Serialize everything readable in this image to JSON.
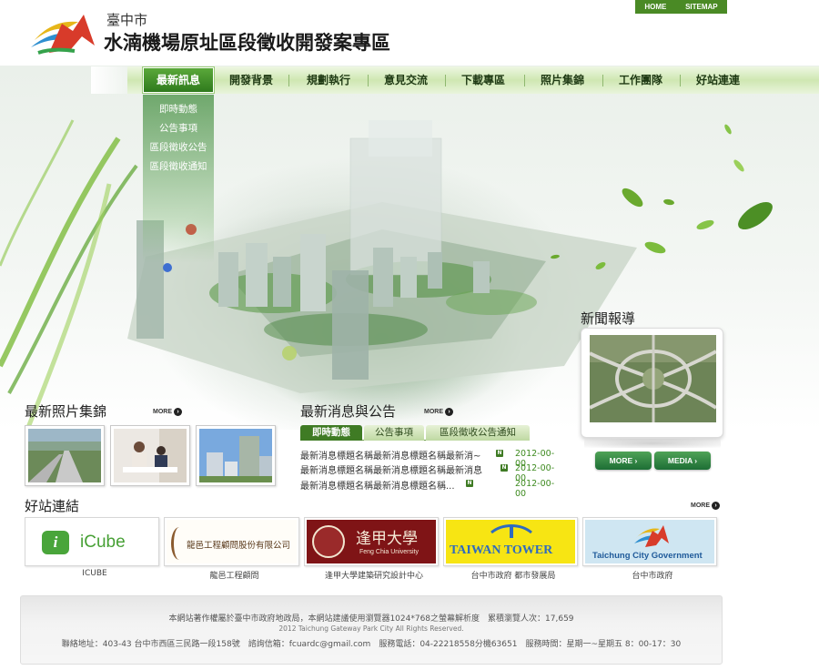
{
  "utility": {
    "home": "HOME",
    "sitemap": "SITEMAP"
  },
  "header": {
    "city": "臺中市",
    "title": "水湳機場原址區段徵收開發案專區"
  },
  "nav": {
    "items": [
      "最新訊息",
      "開發背景",
      "規劃執行",
      "意見交流",
      "下載專區",
      "照片集錦",
      "工作團隊",
      "好站連連"
    ],
    "active": "最新訊息"
  },
  "submenu": [
    "即時動態",
    "公告事項",
    "區段徵收公告",
    "區段徵收通知"
  ],
  "photos": {
    "title": "最新照片集錦",
    "more": "MORE"
  },
  "news": {
    "title": "最新消息與公告",
    "more": "MORE",
    "tabs": [
      "即時動態",
      "公告事項",
      "區段徵收公告通知"
    ],
    "items": [
      {
        "text": "最新消息標題名稱最新消息標題名稱最新消~",
        "date": "2012-00-00"
      },
      {
        "text": "最新消息標題名稱最新消息標題名稱最新消息",
        "date": "2012-00-00"
      },
      {
        "text": "最新消息標題名稱最新消息標題名稱...",
        "date": "2012-00-00"
      }
    ]
  },
  "media": {
    "title": "新聞報導",
    "more_btn": "MORE",
    "media_btn": "MEDIA"
  },
  "links": {
    "title": "好站連結",
    "more": "MORE",
    "items": [
      {
        "logo_text": "iCube",
        "caption": "ICUBE"
      },
      {
        "logo_text": "龍邑工程顧問股份有限公司",
        "caption": "龍邑工程顧問"
      },
      {
        "logo_text": "逢甲大學",
        "logo_sub": "Feng Chia University",
        "caption": "逢甲大學建築研究設計中心"
      },
      {
        "logo_text": "TAIWAN TOWER",
        "caption": "台中市政府 都市發展局"
      },
      {
        "logo_text": "Taichung City Government",
        "caption": "台中市政府"
      }
    ]
  },
  "footer": {
    "line1": "本網站著作權屬於臺中市政府地政局，本網站建議使用瀏覽器1024*768之螢幕解析度　累積瀏覽人次：17,659",
    "line2": "2012 Taichung Gateway Park City All Rights Reserved.",
    "line3": "聯絡地址：403-43 台中市西區三民路一段158號　諮詢信箱：fcuardc@gmail.com　服務電話：04-22218558分機63651　服務時間：星期一~星期五 8：00-17：30"
  },
  "colors": {
    "brand_green": "#3f7b24",
    "nav_green": "#cfe7b2",
    "date_green": "#3d8a1f"
  }
}
